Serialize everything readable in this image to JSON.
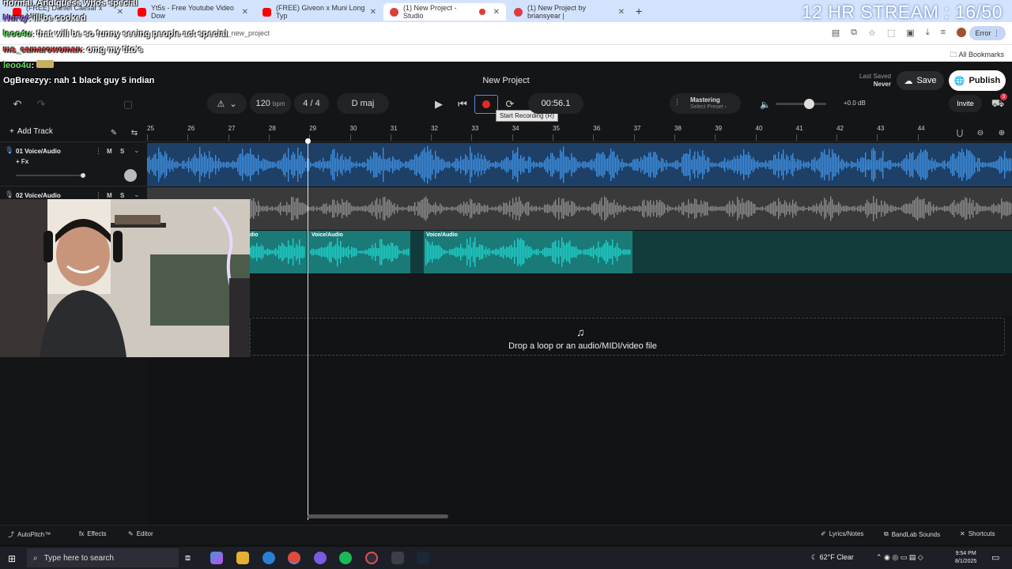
{
  "browser": {
    "tabs": [
      {
        "label": "(FREE) Daniel Caesar x Masta",
        "active": false
      },
      {
        "label": "Yt5s - Free Youtube Video Dow",
        "active": false
      },
      {
        "label": "(FREE) Giveon x Muni Long Typ",
        "active": false
      },
      {
        "label": "(1) New Project - Studio",
        "active": true
      },
      {
        "label": "(1) New Project by briansyear |",
        "active": false
      }
    ],
    "url": "ry_new_project",
    "error_label": "Error",
    "bookmarks_label": "All Bookmarks"
  },
  "stream": {
    "title": "12 HR STREAM : 16/50"
  },
  "chat": [
    {
      "user": "",
      "text": "normal. And guess whos special"
    },
    {
      "user": "Nurvy",
      "text": ": ill be cooked"
    },
    {
      "user": "leoo4u",
      "text": ": that will be so funny seeing people act special"
    },
    {
      "user": "ms_camarowoman",
      "text": ": omg my tito's"
    },
    {
      "user": "leoo4u",
      "text": ":"
    },
    {
      "user": "OgBreezyy",
      "text": ": nah 1 black guy 5 indian"
    }
  ],
  "app": {
    "project_title": "New Project",
    "last_saved_label": "Last Saved",
    "last_saved_value": "Never",
    "save_label": "Save",
    "publish_label": "Publish",
    "invite_label": "Invite",
    "notif_count": "3",
    "tempo": "120",
    "tempo_unit": "bpm",
    "time_sig": "4 / 4",
    "key": "D maj",
    "time": "00:56.1",
    "tooltip": "Start Recording (R)",
    "mastering_label": "Mastering",
    "mastering_preset": "Select Preset",
    "volume_db": "+0.0 dB",
    "add_track_label": "Add Track",
    "volume_level": 0.56
  },
  "ruler": {
    "bars": [
      "25",
      "26",
      "27",
      "28",
      "29",
      "30",
      "31",
      "32",
      "33",
      "34",
      "35",
      "36",
      "37",
      "38",
      "39",
      "40",
      "41",
      "42",
      "43",
      "44"
    ]
  },
  "tracks": [
    {
      "number": "01",
      "name": "Voice/Audio",
      "fx_label": "+ Fx",
      "mute": "M",
      "solo": "S"
    },
    {
      "number": "02",
      "name": "Voice/Audio",
      "mute": "M",
      "solo": "S"
    }
  ],
  "clips": [
    {
      "label": "Voice/Audio"
    },
    {
      "label": "Voice/Audio"
    },
    {
      "label": "Voice/Audio"
    }
  ],
  "dropzone": {
    "text": "Drop a loop or an audio/MIDI/video file"
  },
  "bottom_bar": {
    "autopitch": "AutoPitch™",
    "effects": "Effects",
    "editor": "Editor",
    "lyrics": "Lyrics/Notes",
    "sounds": "BandLab Sounds",
    "shortcuts": "Shortcuts"
  },
  "taskbar": {
    "search_placeholder": "Type here to search",
    "weather": "62°F  Clear",
    "time": "9:54 PM",
    "date": "8/1/2025"
  },
  "colors": {
    "waveform_blue": "#3d8fe0",
    "waveform_gray": "#8a8a8a",
    "waveform_teal": "#1fd0c8",
    "record_red": "#e8272b"
  }
}
